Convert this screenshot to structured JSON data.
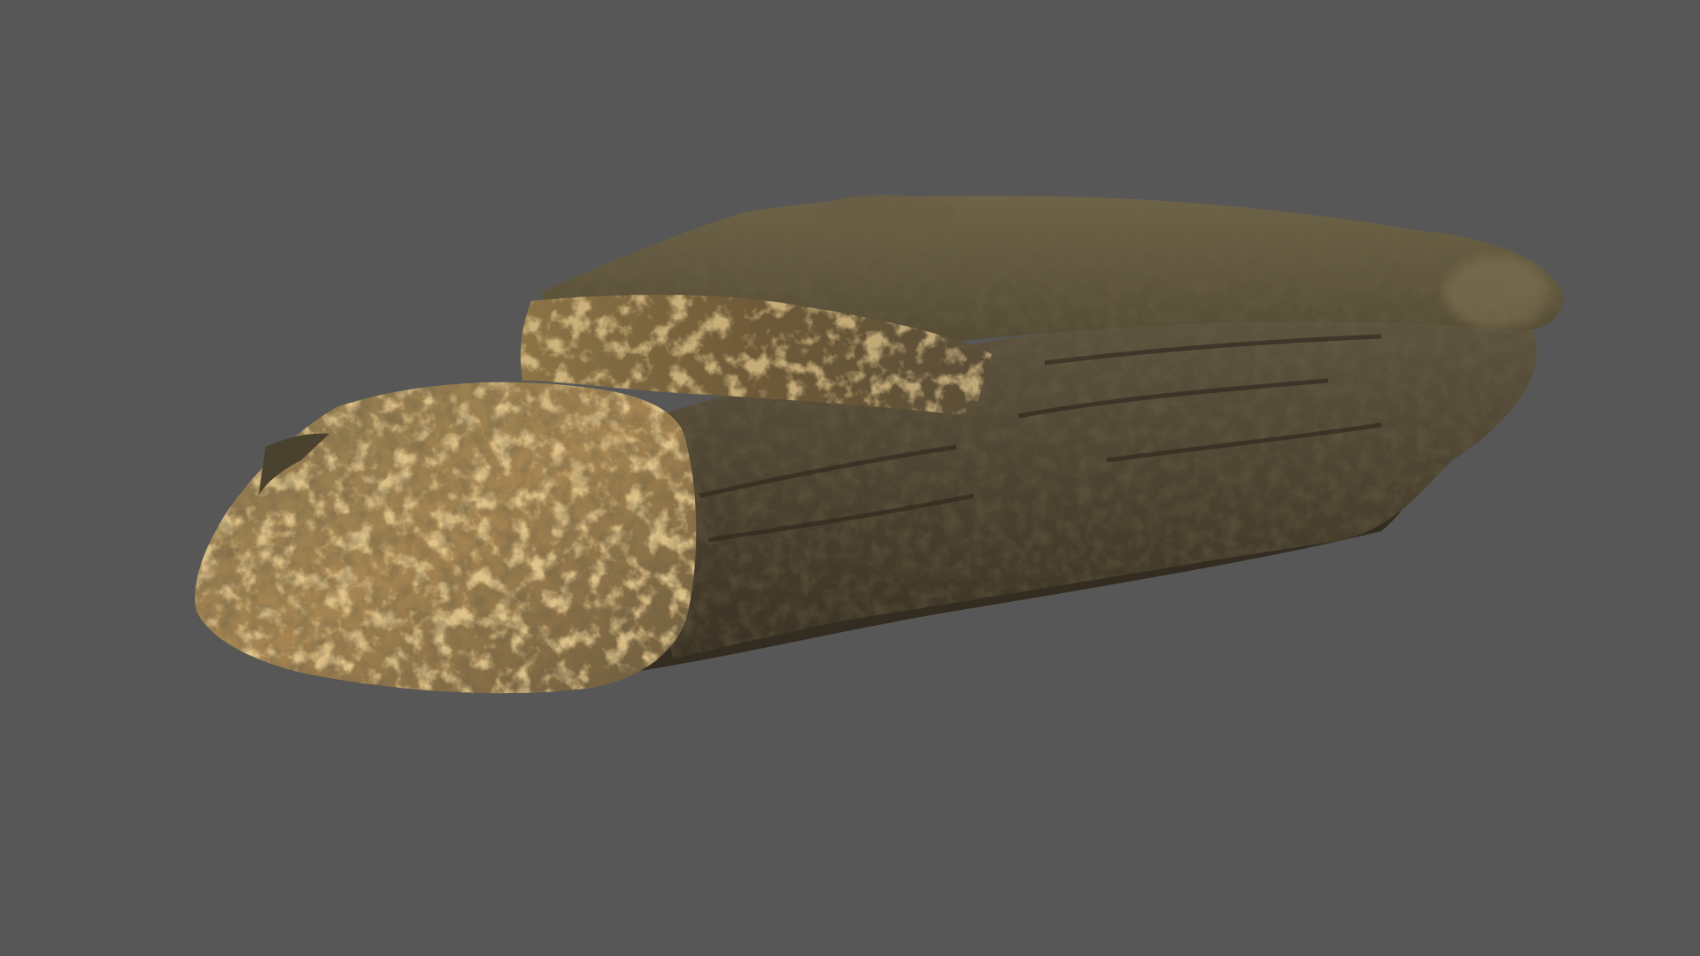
{
  "scene": {
    "subject_icon": "rock-icon",
    "colors": {
      "background": "#575757",
      "rock_dark": "#3d3526",
      "rock_mid": "#5f5540",
      "rock_light": "#7a6c4f",
      "lichen": "#c79a4c",
      "lichen_light": "#d9ae62",
      "shadow": "#2b261c"
    }
  }
}
